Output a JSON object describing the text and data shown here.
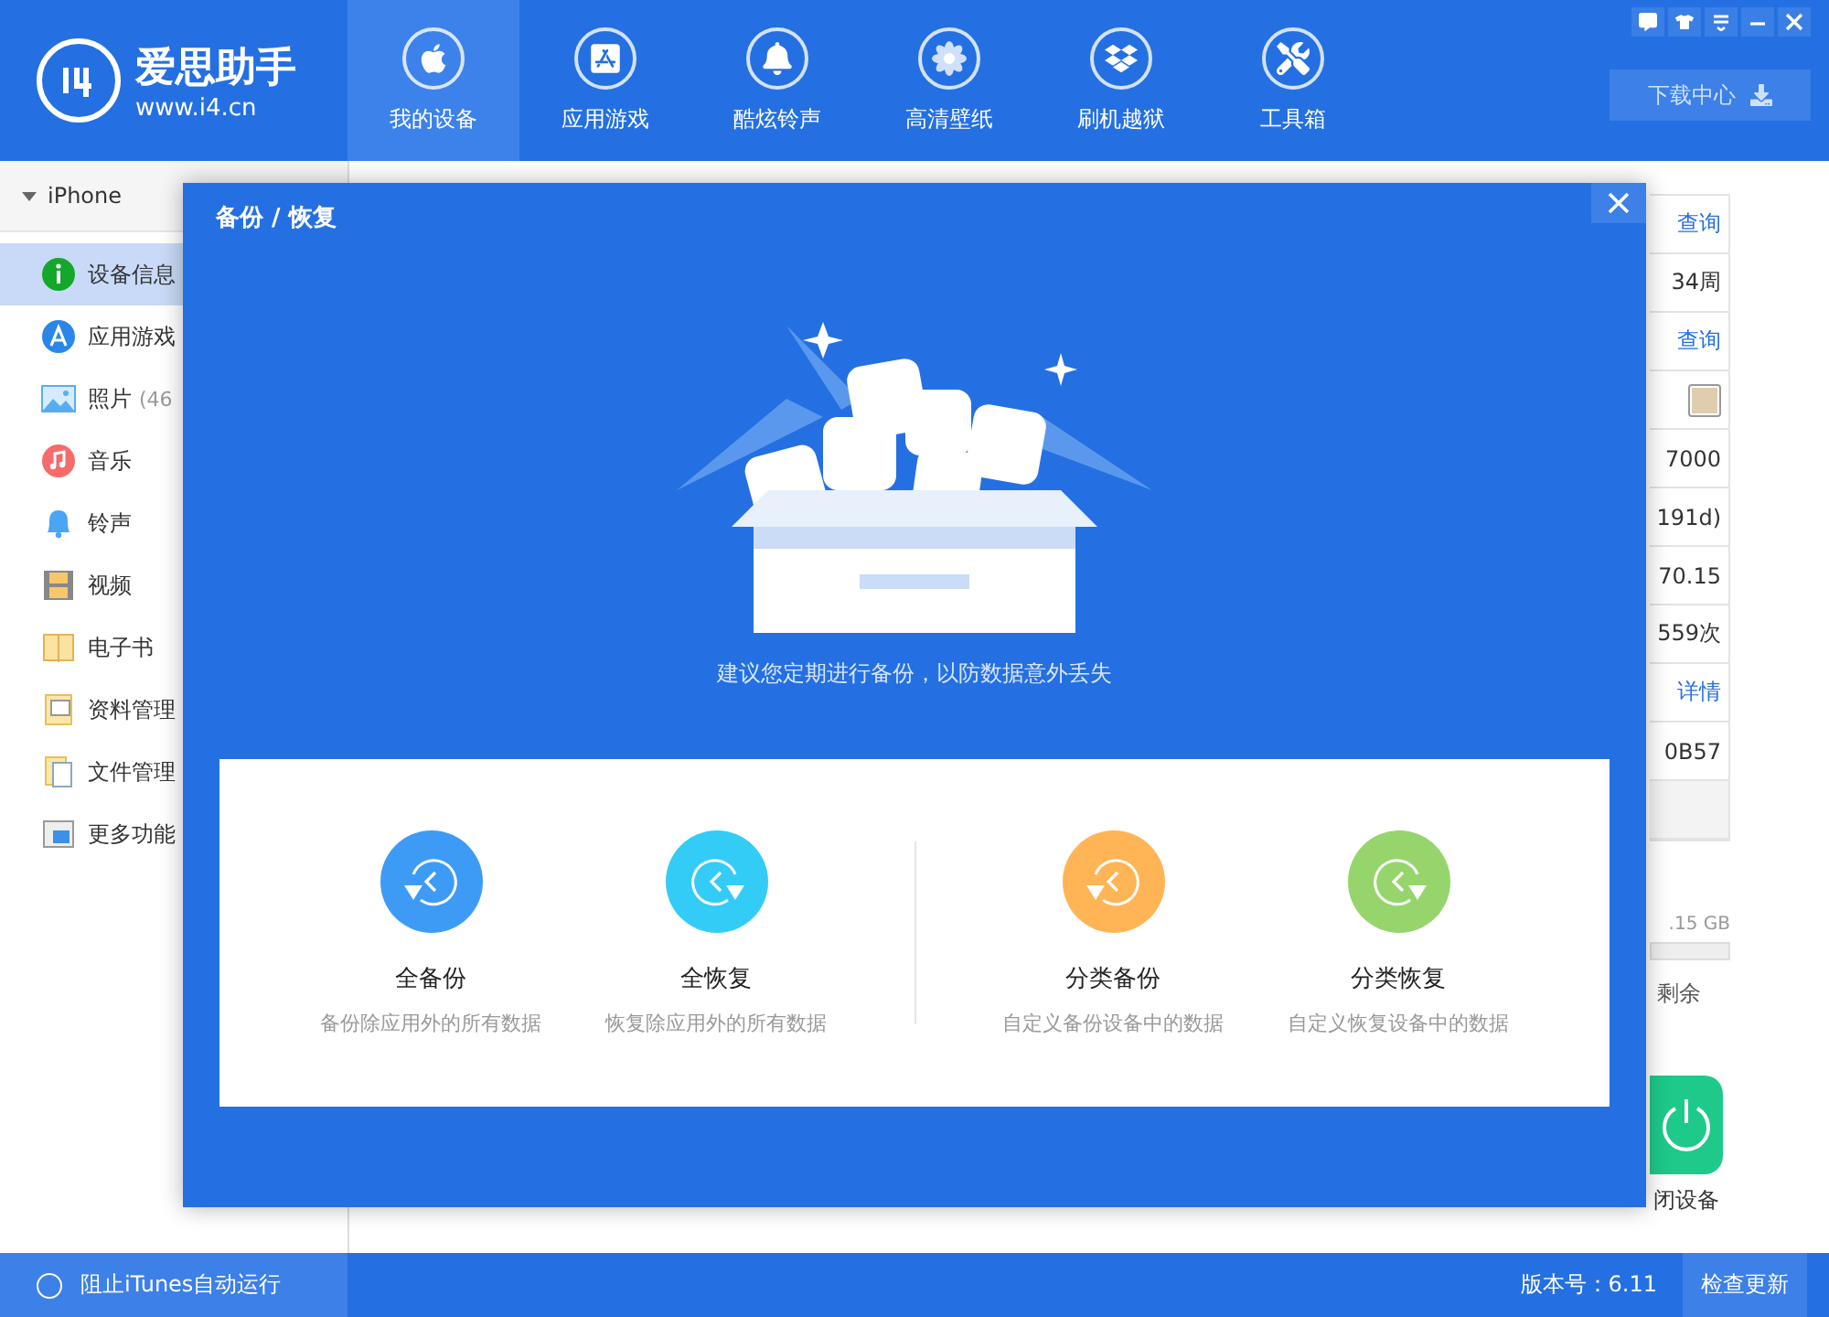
{
  "app": {
    "logo_title": "爱思助手",
    "logo_url": "www.i4.cn"
  },
  "nav_tabs": [
    {
      "label": "我的设备",
      "selected": true,
      "kind": "apple"
    },
    {
      "label": "应用游戏",
      "selected": false,
      "kind": "appstore"
    },
    {
      "label": "酷炫铃声",
      "selected": false,
      "kind": "bell"
    },
    {
      "label": "高清壁纸",
      "selected": false,
      "kind": "flower"
    },
    {
      "label": "刷机越狱",
      "selected": false,
      "kind": "box"
    },
    {
      "label": "工具箱",
      "selected": false,
      "kind": "tools"
    }
  ],
  "download_button": {
    "label": "下载中心"
  },
  "sidebar": {
    "device": {
      "label": "iPhone",
      "expanded": true
    },
    "items": [
      {
        "label": "设备信息",
        "selected": true,
        "kind": "info"
      },
      {
        "label": "应用游戏",
        "selected": false,
        "kind": "apps"
      },
      {
        "label": "照片",
        "count": "(46",
        "selected": false,
        "kind": "photo"
      },
      {
        "label": "音乐",
        "selected": false,
        "kind": "music"
      },
      {
        "label": "铃声",
        "selected": false,
        "kind": "bell"
      },
      {
        "label": "视频",
        "selected": false,
        "kind": "video"
      },
      {
        "label": "电子书",
        "selected": false,
        "kind": "book"
      },
      {
        "label": "资料管理",
        "selected": false,
        "kind": "contacts"
      },
      {
        "label": "文件管理",
        "selected": false,
        "kind": "files"
      },
      {
        "label": "更多功能",
        "selected": false,
        "kind": "more"
      }
    ]
  },
  "device_info": {
    "rows": [
      {
        "kind": "link",
        "text": "查询"
      },
      {
        "kind": "text",
        "text": "34周"
      },
      {
        "kind": "link",
        "text": "查询"
      },
      {
        "kind": "swatch",
        "color": "#e0cdb0"
      },
      {
        "kind": "text",
        "text": "7000"
      },
      {
        "kind": "text",
        "text": "191d)"
      },
      {
        "kind": "text",
        "text": "70.15"
      },
      {
        "kind": "text",
        "text": "559次"
      },
      {
        "kind": "link",
        "text": "详情"
      },
      {
        "kind": "text",
        "text": "0B57"
      },
      {
        "kind": "blank"
      }
    ],
    "capacity": ".15 GB",
    "remaining": "剩余",
    "power_button": "闭设备"
  },
  "modal": {
    "title": "备份 / 恢复",
    "caption": "建议您定期进行备份，以防数据意外丢失",
    "groups": [
      {
        "options": [
          {
            "kind": "backup",
            "title": "全备份",
            "description": "备份除应用外的所有数据",
            "color": "#3d9bf5"
          },
          {
            "kind": "restore",
            "title": "全恢复",
            "description": "恢复除应用外的所有数据",
            "color": "#33ccf7"
          }
        ]
      },
      {
        "options": [
          {
            "kind": "backup",
            "title": "分类备份",
            "description": "自定义备份设备中的数据",
            "color": "#ffb455"
          },
          {
            "kind": "restore",
            "title": "分类恢复",
            "description": "自定义恢复设备中的数据",
            "color": "#96d56c"
          }
        ]
      }
    ]
  },
  "footer": {
    "itunes_toggle": {
      "label": "阻止iTunes自动运行",
      "checked": false
    },
    "version": "版本号：6.11",
    "update_button": "检查更新"
  }
}
